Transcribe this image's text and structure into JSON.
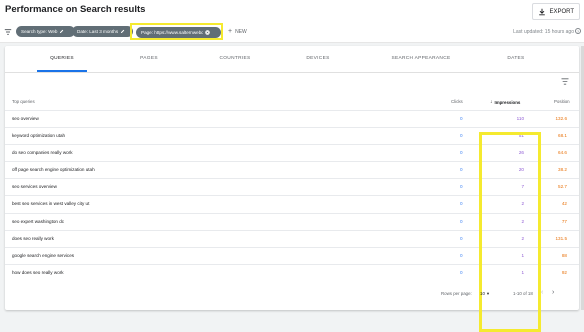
{
  "header": {
    "title": "Performance on Search results",
    "export_label": "EXPORT"
  },
  "filters": {
    "chips": [
      {
        "label": "Search type: Web"
      },
      {
        "label": "Date: Last 3 months"
      },
      {
        "label": "Page: https://www.salternwebdn..."
      }
    ],
    "new_label": "NEW",
    "last_updated": "Last updated: 15 hours ago"
  },
  "tabs": [
    {
      "label": "QUERIES",
      "active": true
    },
    {
      "label": "PAGES"
    },
    {
      "label": "COUNTRIES"
    },
    {
      "label": "DEVICES"
    },
    {
      "label": "SEARCH APPEARANCE"
    },
    {
      "label": "DATES"
    }
  ],
  "table": {
    "headers": {
      "query": "Top queries",
      "clicks": "Clicks",
      "impressions": "Impressions",
      "position": "Position"
    },
    "rows": [
      {
        "query": "seo overview",
        "clicks": "0",
        "impressions": "110",
        "position": "132.6"
      },
      {
        "query": "keyword optimization utah",
        "clicks": "0",
        "impressions": "51",
        "position": "68.1"
      },
      {
        "query": "do seo companies really work",
        "clicks": "0",
        "impressions": "26",
        "position": "64.6"
      },
      {
        "query": "off page search engine optimization utah",
        "clicks": "0",
        "impressions": "20",
        "position": "38.2"
      },
      {
        "query": "seo services overview",
        "clicks": "0",
        "impressions": "7",
        "position": "52.7"
      },
      {
        "query": "best seo services in west valley city ut",
        "clicks": "0",
        "impressions": "2",
        "position": "42"
      },
      {
        "query": "seo expert washington dc",
        "clicks": "0",
        "impressions": "2",
        "position": "77"
      },
      {
        "query": "does seo really work",
        "clicks": "0",
        "impressions": "2",
        "position": "131.5"
      },
      {
        "query": "google search engine services",
        "clicks": "0",
        "impressions": "1",
        "position": "88"
      },
      {
        "query": "how does seo really work",
        "clicks": "0",
        "impressions": "1",
        "position": "92"
      }
    ]
  },
  "pagination": {
    "rows_per_page_label": "Rows per page:",
    "rows_per_page_value": "10",
    "range": "1-10 of 18"
  },
  "colors": {
    "clicks": "#4285f4",
    "impressions": "#8e5ad4",
    "position": "#e8710a",
    "highlight": "#f5ea2f"
  }
}
